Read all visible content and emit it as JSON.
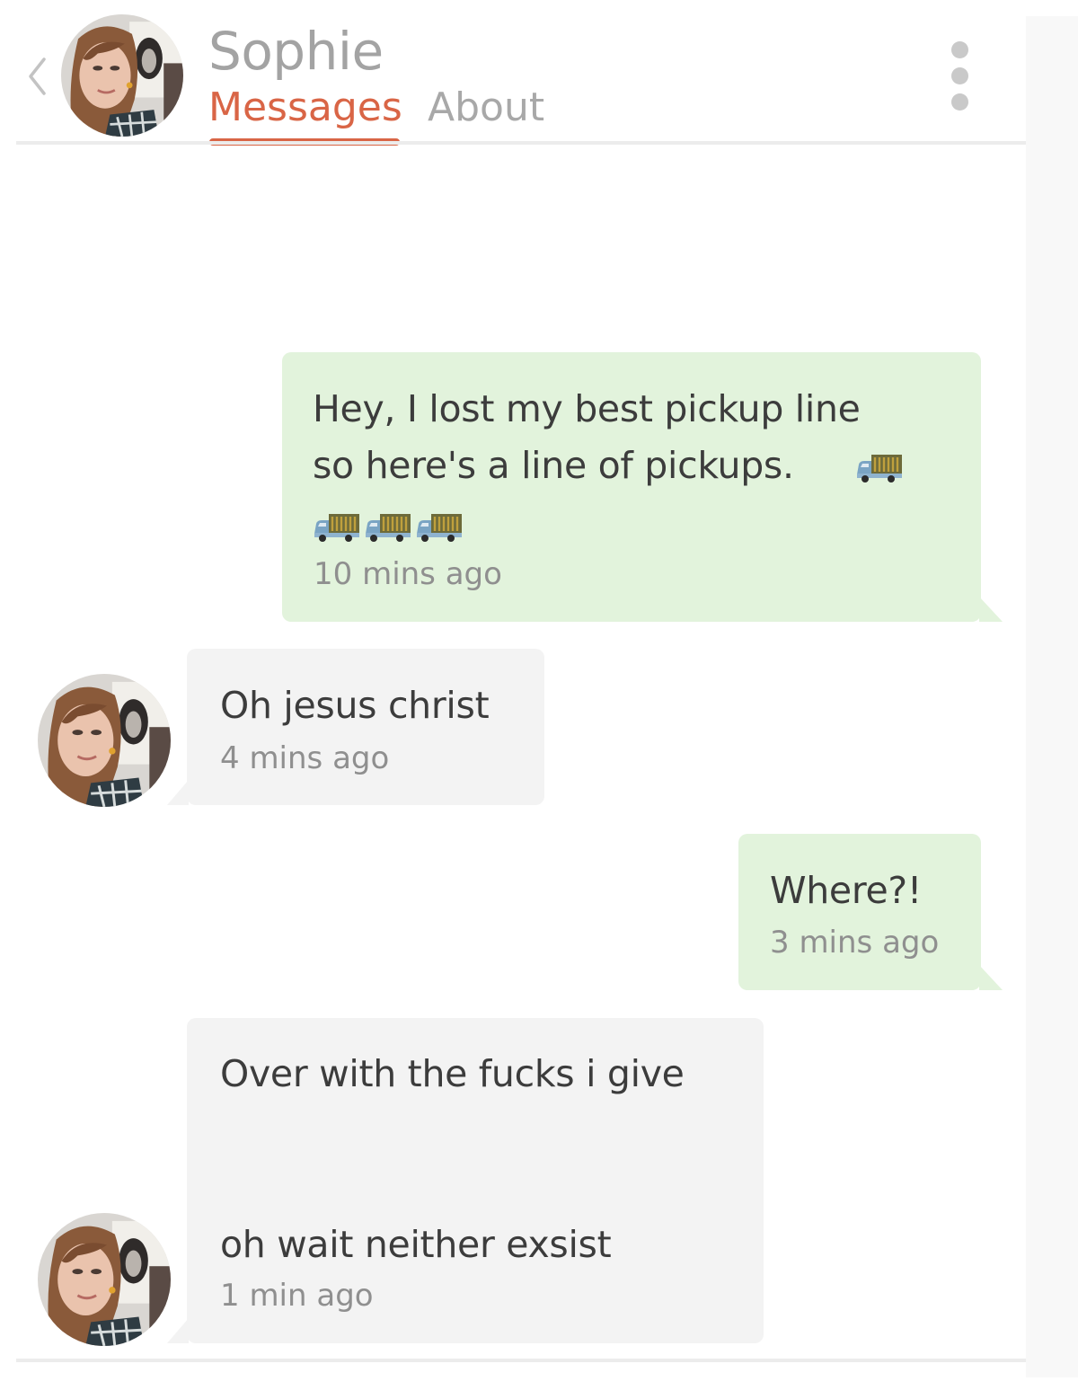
{
  "header": {
    "back_icon": "chevron-left-icon",
    "contact_name": "Sophie",
    "tabs": [
      {
        "label": "Messages",
        "active": true
      },
      {
        "label": "About",
        "active": false
      }
    ],
    "menu_icon": "vertical-ellipsis-icon",
    "accent_color": "#d96546"
  },
  "messages": [
    {
      "direction": "outgoing",
      "lines": [
        "Hey, I lost my best pickup line",
        "so here's a line of pickups."
      ],
      "emoji": "delivery-truck-icon",
      "emoji_count": 4,
      "time": "10 mins ago"
    },
    {
      "direction": "incoming",
      "lines": [
        "Oh jesus christ"
      ],
      "time": "4 mins ago"
    },
    {
      "direction": "outgoing",
      "lines": [
        "Where?!"
      ],
      "time": "3 mins ago"
    },
    {
      "direction": "incoming",
      "lines": [
        "Over with the fucks i give",
        "oh wait neither exsist"
      ],
      "time": "1 min ago"
    }
  ],
  "colors": {
    "outgoing_bubble": "#e2f3dc",
    "incoming_bubble": "#f3f3f3",
    "text": "#3c3c3c",
    "timestamp": "#8f8f8f"
  }
}
